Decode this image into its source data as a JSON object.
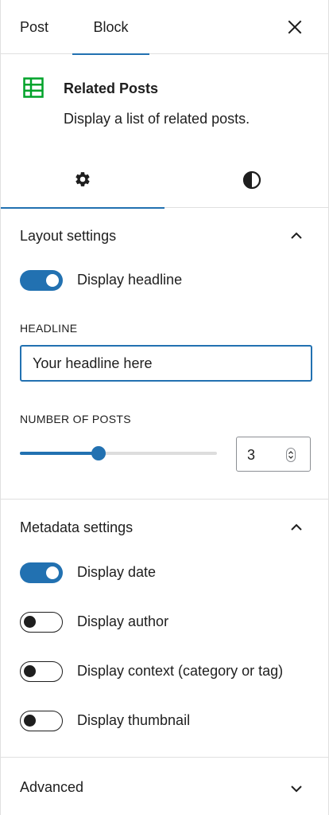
{
  "header": {
    "tabs": [
      {
        "label": "Post",
        "active": false
      },
      {
        "label": "Block",
        "active": true
      }
    ],
    "close_icon": "close-icon"
  },
  "block_card": {
    "icon": "table-icon",
    "icon_color": "#00a32a",
    "title": "Related Posts",
    "description": "Display a list of related posts."
  },
  "inspector_tabs": [
    {
      "icon": "gear-icon",
      "active": true
    },
    {
      "icon": "contrast-icon",
      "active": false
    }
  ],
  "layout_settings": {
    "title": "Layout settings",
    "expanded": true,
    "display_headline": {
      "label": "Display headline",
      "checked": true
    },
    "headline": {
      "label": "HEADLINE",
      "placeholder": "Your headline here"
    },
    "number_of_posts": {
      "label": "NUMBER OF POSTS",
      "value": "3",
      "slider_fraction": 0.4
    }
  },
  "metadata_settings": {
    "title": "Metadata settings",
    "expanded": true,
    "toggles": [
      {
        "label": "Display date",
        "checked": true
      },
      {
        "label": "Display author",
        "checked": false
      },
      {
        "label": "Display context (category or tag)",
        "checked": false
      },
      {
        "label": "Display thumbnail",
        "checked": false
      }
    ]
  },
  "advanced": {
    "title": "Advanced",
    "expanded": false
  },
  "colors": {
    "accent": "#2271b1",
    "border": "#e0e0e0",
    "text": "#1e1e1e"
  }
}
